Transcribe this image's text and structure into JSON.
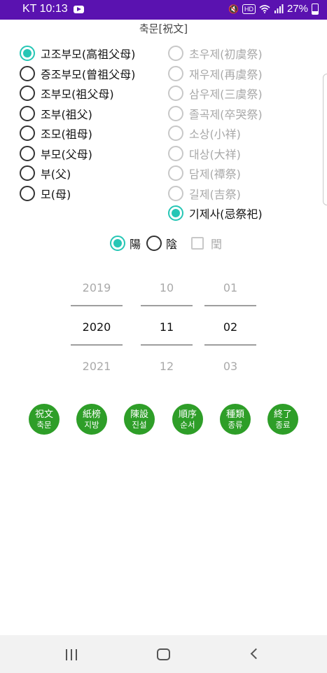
{
  "status_bar": {
    "carrier_time": "KT 10:13",
    "hd_badge": "HD",
    "battery": "27%",
    "battery_level": 0.27
  },
  "screen_title": "축문[祝文]",
  "left_options": [
    {
      "label": "고조부모(高祖父母)",
      "checked": true
    },
    {
      "label": "증조부모(曾祖父母)",
      "checked": false
    },
    {
      "label": "조부모(祖父母)",
      "checked": false
    },
    {
      "label": "조부(祖父)",
      "checked": false
    },
    {
      "label": "조모(祖母)",
      "checked": false
    },
    {
      "label": "부모(父母)",
      "checked": false
    },
    {
      "label": "부(父)",
      "checked": false
    },
    {
      "label": "모(母)",
      "checked": false
    }
  ],
  "right_options": [
    {
      "label": "초우제(初虞祭)",
      "checked": false,
      "enabled": false
    },
    {
      "label": "재우제(再虞祭)",
      "checked": false,
      "enabled": false
    },
    {
      "label": "삼우제(三虞祭)",
      "checked": false,
      "enabled": false
    },
    {
      "label": "졸곡제(卒哭祭)",
      "checked": false,
      "enabled": false
    },
    {
      "label": "소상(小祥)",
      "checked": false,
      "enabled": false
    },
    {
      "label": "대상(大祥)",
      "checked": false,
      "enabled": false
    },
    {
      "label": "담제(禫祭)",
      "checked": false,
      "enabled": false
    },
    {
      "label": "길제(吉祭)",
      "checked": false,
      "enabled": false
    },
    {
      "label": "기제사(忌祭祀)",
      "checked": true,
      "enabled": true
    }
  ],
  "calendar": {
    "yang_label": "陽",
    "yin_label": "陰",
    "leap_label": "閏",
    "yang_checked": true,
    "yin_checked": false,
    "leap_checked": false
  },
  "picker": {
    "year": {
      "prev": "2019",
      "current": "2020",
      "next": "2021"
    },
    "month": {
      "prev": "10",
      "current": "11",
      "next": "12"
    },
    "day": {
      "prev": "01",
      "current": "02",
      "next": "03"
    }
  },
  "actions": [
    {
      "top": "祝文",
      "bottom": "축문"
    },
    {
      "top": "紙榜",
      "bottom": "지방"
    },
    {
      "top": "陳設",
      "bottom": "진설"
    },
    {
      "top": "順序",
      "bottom": "순서"
    },
    {
      "top": "種類",
      "bottom": "종류"
    },
    {
      "top": "終了",
      "bottom": "종료"
    }
  ],
  "colors": {
    "status_bar": "#5a12b0",
    "radio_checked": "#26c6b5",
    "action_button": "#2e9e28"
  },
  "icons": {
    "status_left": "youtube-icon",
    "status_right": [
      "mute-icon",
      "wifi-icon",
      "signal-icon",
      "battery-icon"
    ],
    "nav": [
      "recent-apps-icon",
      "home-icon",
      "back-icon"
    ]
  }
}
